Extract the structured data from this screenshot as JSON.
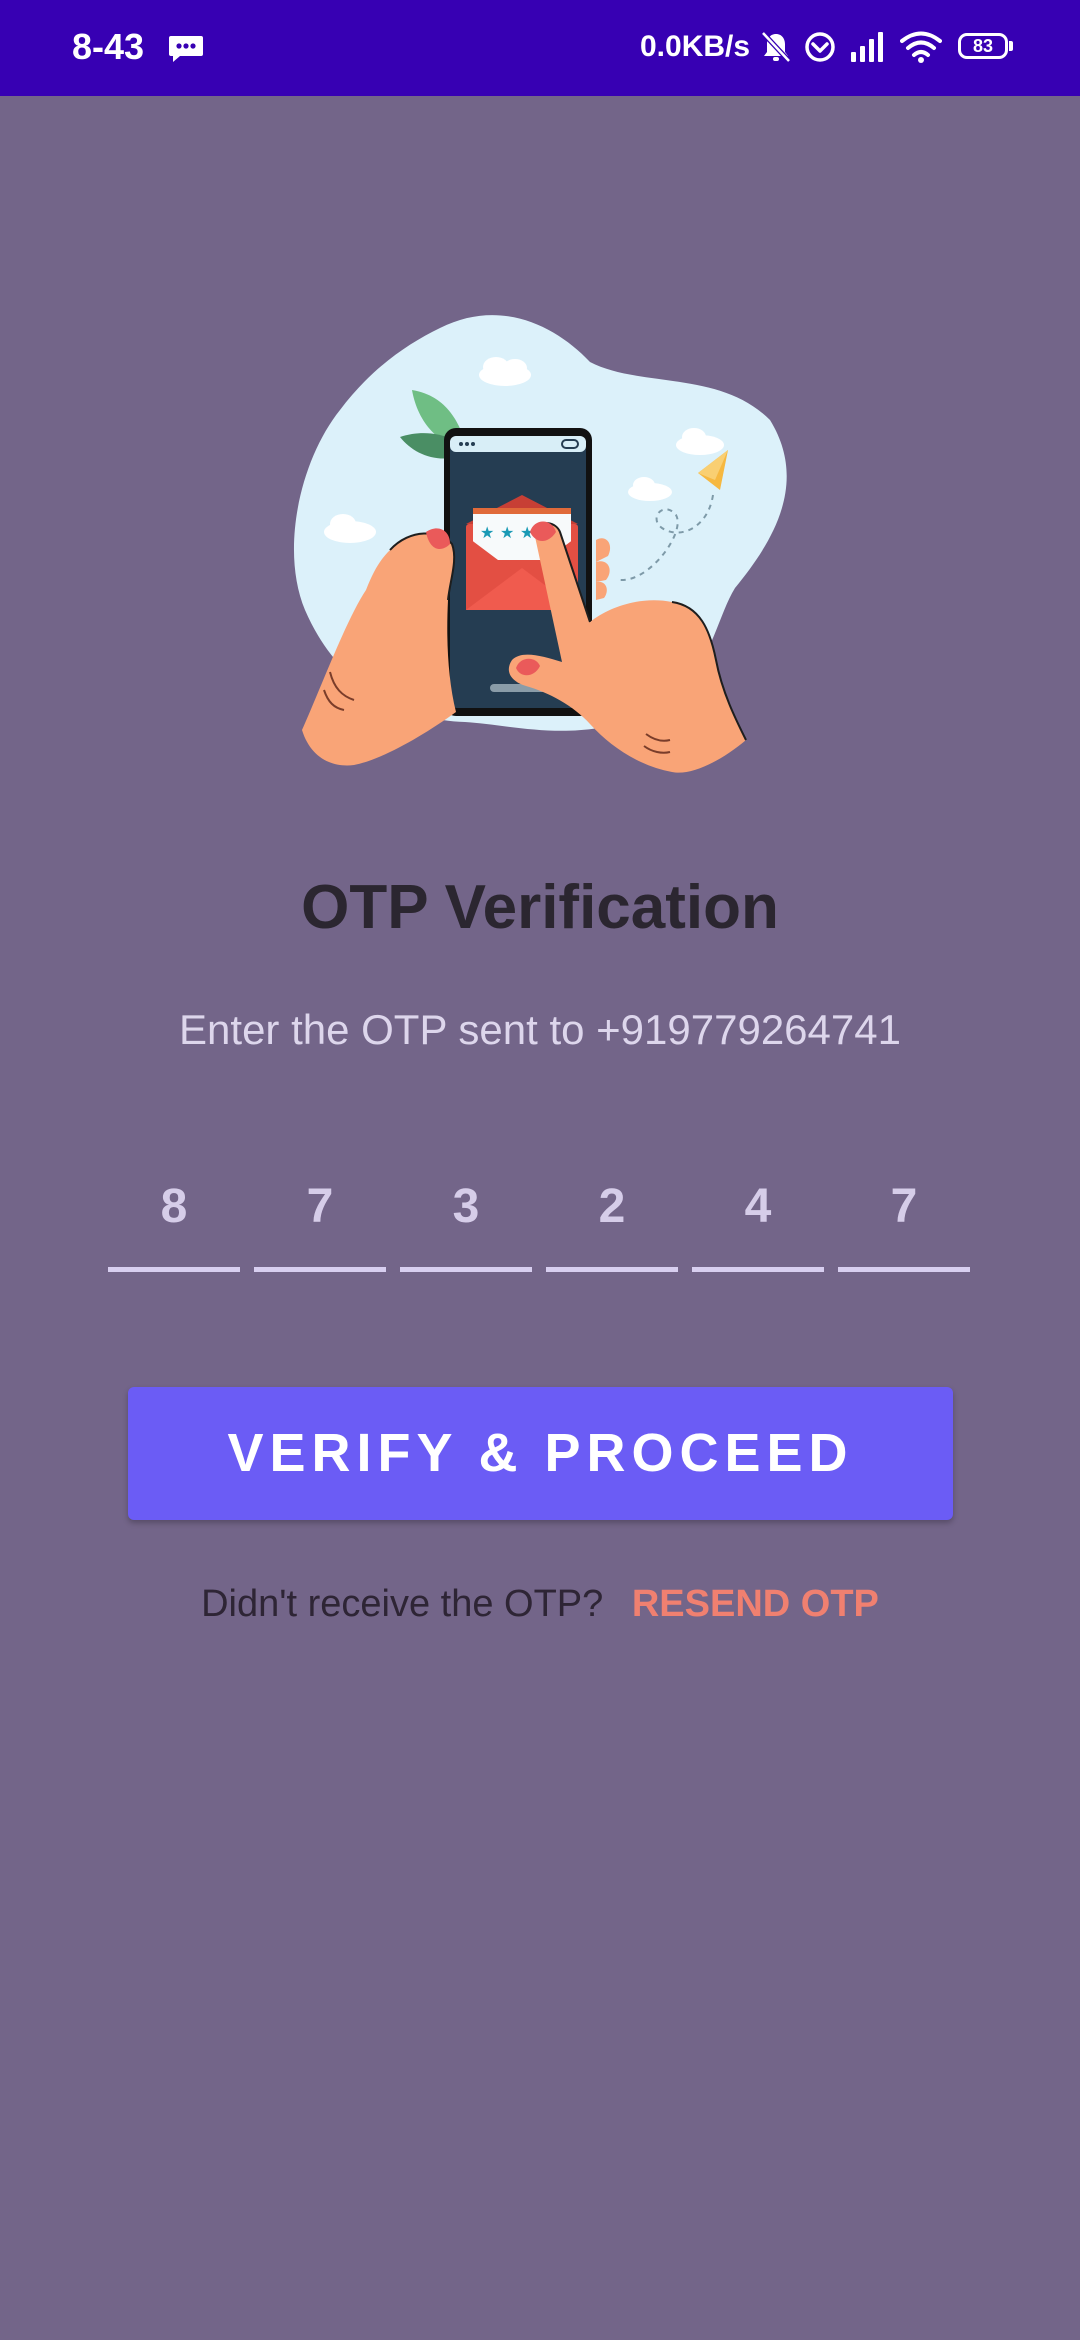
{
  "status_bar": {
    "time": "8-43",
    "network_speed": "0.0KB/s",
    "battery_level": "83",
    "icons": [
      "message-icon",
      "mute-icon",
      "sync-icon",
      "signal-icon",
      "wifi-icon",
      "battery-icon"
    ]
  },
  "illustration": {
    "icon": "phone-otp-illustration"
  },
  "page": {
    "title": "OTP Verification",
    "subtitle": "Enter the OTP sent to +919779264741"
  },
  "otp": {
    "digits": [
      "8",
      "7",
      "3",
      "2",
      "4",
      "7"
    ]
  },
  "actions": {
    "verify_label": "VERIFY & PROCEED",
    "resend_question": "Didn't receive the OTP?",
    "resend_label": "RESEND OTP"
  },
  "colors": {
    "status_bar": "#3700b3",
    "background": "#736589",
    "button": "#6b5cf5",
    "resend_link": "#f08070"
  }
}
